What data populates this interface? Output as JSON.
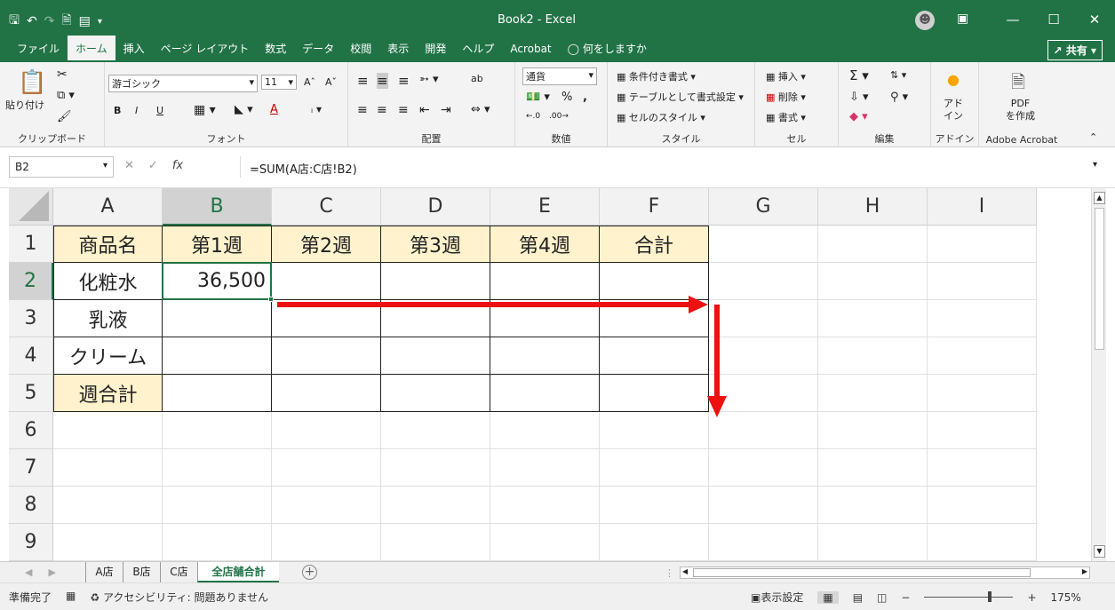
{
  "titlebar": {
    "title": "Book2 - Excel",
    "qat_icons": [
      "save-icon",
      "undo-icon",
      "redo-icon",
      "new-doc-icon",
      "form-icon",
      "customize-icon"
    ]
  },
  "menu": {
    "tabs": [
      "ファイル",
      "ホーム",
      "挿入",
      "ページ レイアウト",
      "数式",
      "データ",
      "校閲",
      "表示",
      "開発",
      "ヘルプ",
      "Acrobat"
    ],
    "active_tab": "ホーム",
    "search": "何をしますか",
    "share": "共有"
  },
  "ribbon": {
    "clipboard": {
      "paste": "貼り付け",
      "label": "クリップボード"
    },
    "font": {
      "name": "游ゴシック",
      "size": "11",
      "bold": "B",
      "italic": "I",
      "underline": "U",
      "label": "フォント"
    },
    "alignment": {
      "label": "配置"
    },
    "number": {
      "format": "通貨",
      "percent": "%",
      "comma": ",",
      "label": "数値"
    },
    "styles": {
      "conditional": "条件付き書式",
      "table": "テーブルとして書式設定",
      "cell_styles": "セルのスタイル",
      "label": "スタイル"
    },
    "cells": {
      "insert": "挿入",
      "delete": "削除",
      "format": "書式",
      "label": "セル"
    },
    "editing": {
      "label": "編集"
    },
    "addins": {
      "button": "アド\nイン",
      "label": "アドイン"
    },
    "acrobat": {
      "button": "PDF\nを作成",
      "label": "Adobe Acrobat"
    }
  },
  "formula_bar": {
    "name_box": "B2",
    "cancel": "✕",
    "enter": "✓",
    "fx": "fx",
    "formula": "=SUM(A店:C店!B2)"
  },
  "sheet": {
    "columns": [
      "A",
      "B",
      "C",
      "D",
      "E",
      "F",
      "G",
      "H",
      "I"
    ],
    "rows": [
      "1",
      "2",
      "3",
      "4",
      "5",
      "6",
      "7",
      "8",
      "9"
    ],
    "selected_cell": "B2",
    "cells": {
      "A1": "商品名",
      "B1": "第1週",
      "C1": "第2週",
      "D1": "第3週",
      "E1": "第4週",
      "F1": "合計",
      "A2": "化粧水",
      "B2": "36,500",
      "A3": "乳液",
      "A4": "クリーム",
      "A5": "週合計"
    },
    "header_fill": "#fff2cc",
    "arrow_color": "#ee1111"
  },
  "sheet_tabs": [
    "A店",
    "B店",
    "C店",
    "全店舗合計"
  ],
  "active_sheet": "全店舗合計",
  "status": {
    "ready": "準備完了",
    "accessibility": "アクセシビリティ: 問題ありません",
    "display_settings": "表示設定",
    "zoom": "175%"
  }
}
